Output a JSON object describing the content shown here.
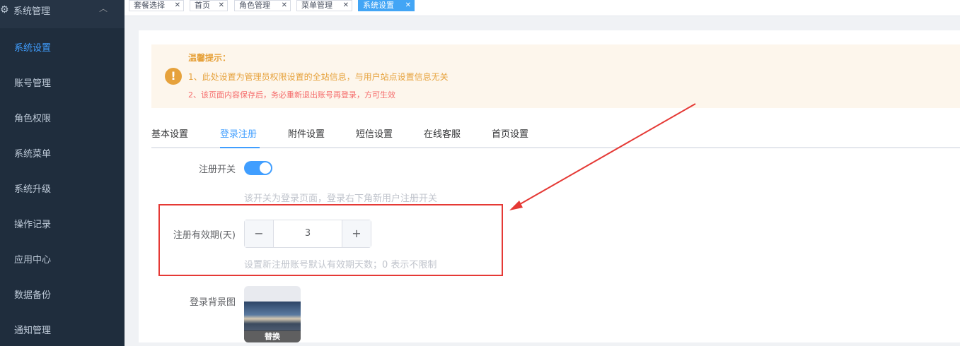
{
  "sidebar": {
    "header": {
      "title": "系统管理"
    },
    "items": [
      {
        "label": "系统设置",
        "active": true
      },
      {
        "label": "账号管理"
      },
      {
        "label": "角色权限"
      },
      {
        "label": "系统菜单"
      },
      {
        "label": "系统升级"
      },
      {
        "label": "操作记录"
      },
      {
        "label": "应用中心"
      },
      {
        "label": "数据备份"
      },
      {
        "label": "通知管理"
      }
    ]
  },
  "tags": [
    {
      "label": "套餐选择"
    },
    {
      "label": "首页"
    },
    {
      "label": "角色管理"
    },
    {
      "label": "菜单管理"
    },
    {
      "label": "系统设置",
      "active": true
    }
  ],
  "alert": {
    "title": "温馨提示：",
    "line1": "1、此处设置为管理员权限设置的全站信息，与用户站点设置信息无关",
    "line2": "2、该页面内容保存后，务必重新退出账号再登录，方可生效"
  },
  "tabs": [
    {
      "label": "基本设置"
    },
    {
      "label": "登录注册",
      "active": true
    },
    {
      "label": "附件设置"
    },
    {
      "label": "短信设置"
    },
    {
      "label": "在线客服"
    },
    {
      "label": "首页设置"
    }
  ],
  "form": {
    "register_switch": {
      "label": "注册开关",
      "on": true,
      "hint": "该开关为登录页面，登录右下角新用户注册开关"
    },
    "register_validity": {
      "label": "注册有效期(天)",
      "value": "3",
      "hint": "设置新注册账号默认有效期天数；0 表示不限制"
    },
    "login_bg": {
      "label": "登录背景图",
      "replace_label": "替换"
    }
  },
  "colors": {
    "accent": "#409eff",
    "annotation": "#e53935",
    "warning": "#e6a23c",
    "danger": "#f56c6c"
  }
}
